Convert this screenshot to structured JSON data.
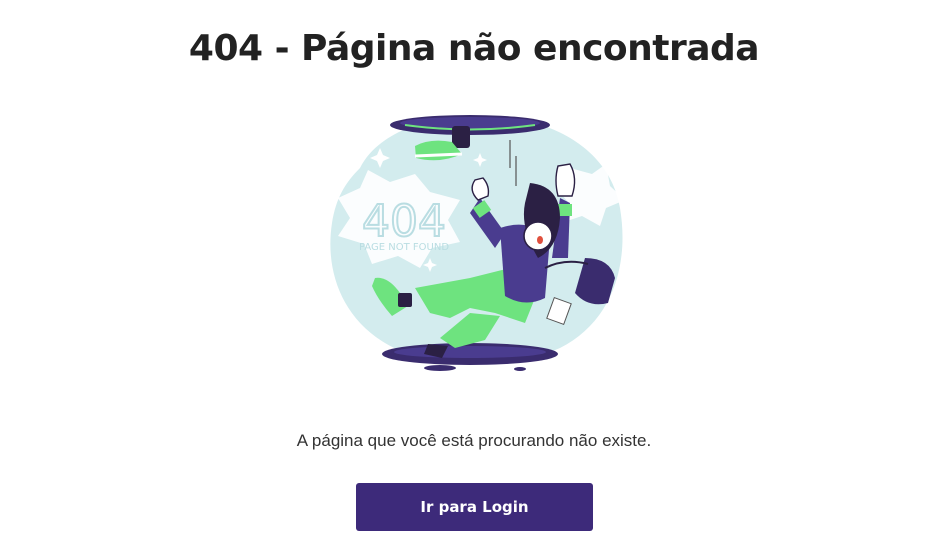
{
  "page": {
    "title": "404 - Página não encontrada",
    "message": "A página que você está procurando não existe.",
    "login_button_label": "Ir para Login"
  },
  "illustration": {
    "big_text": "404",
    "sub_text": "PAGE NOT FOUND",
    "icon": "falling-person-illustration"
  },
  "colors": {
    "primary": "#3d2a7a",
    "illustration_bg": "#d3ecee",
    "hole": "#3a2c6e",
    "green": "#6ee37f",
    "purple_shirt": "#4a3c8f"
  }
}
